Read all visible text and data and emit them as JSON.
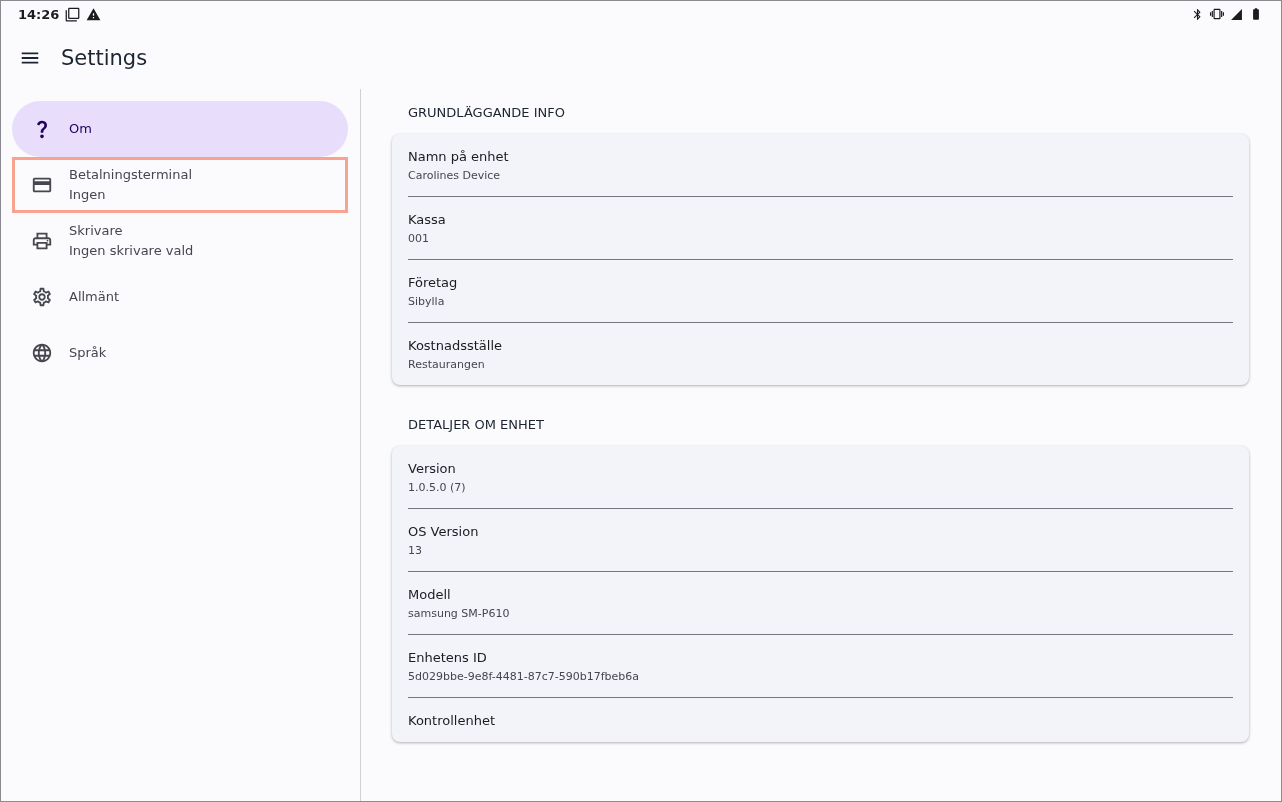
{
  "status_bar": {
    "time": "14:26"
  },
  "app_bar": {
    "title": "Settings"
  },
  "sidebar": {
    "items": [
      {
        "label": "Om",
        "selected": true,
        "highlighted": false
      },
      {
        "label": "Betalningsterminal",
        "subtitle": "Ingen",
        "selected": false,
        "highlighted": true
      },
      {
        "label": "Skrivare",
        "subtitle": "Ingen skrivare vald",
        "selected": false,
        "highlighted": false
      },
      {
        "label": "Allmänt",
        "selected": false,
        "highlighted": false
      },
      {
        "label": "Språk",
        "selected": false,
        "highlighted": false
      }
    ]
  },
  "sections": [
    {
      "title": "GRUNDLÄGGANDE INFO",
      "rows": [
        {
          "label": "Namn på enhet",
          "value": "Carolines Device"
        },
        {
          "label": "Kassa",
          "value": "001"
        },
        {
          "label": "Företag",
          "value": "Sibylla"
        },
        {
          "label": "Kostnadsställe",
          "value": "Restaurangen"
        }
      ]
    },
    {
      "title": "DETALJER OM ENHET",
      "rows": [
        {
          "label": "Version",
          "value": "1.0.5.0 (7)"
        },
        {
          "label": "OS Version",
          "value": "13"
        },
        {
          "label": "Modell",
          "value": "samsung SM-P610"
        },
        {
          "label": "Enhetens ID",
          "value": "5d029bbe-9e8f-4481-87c7-590b17fbeb6a"
        },
        {
          "label": "Kontrollenhet"
        }
      ]
    }
  ]
}
